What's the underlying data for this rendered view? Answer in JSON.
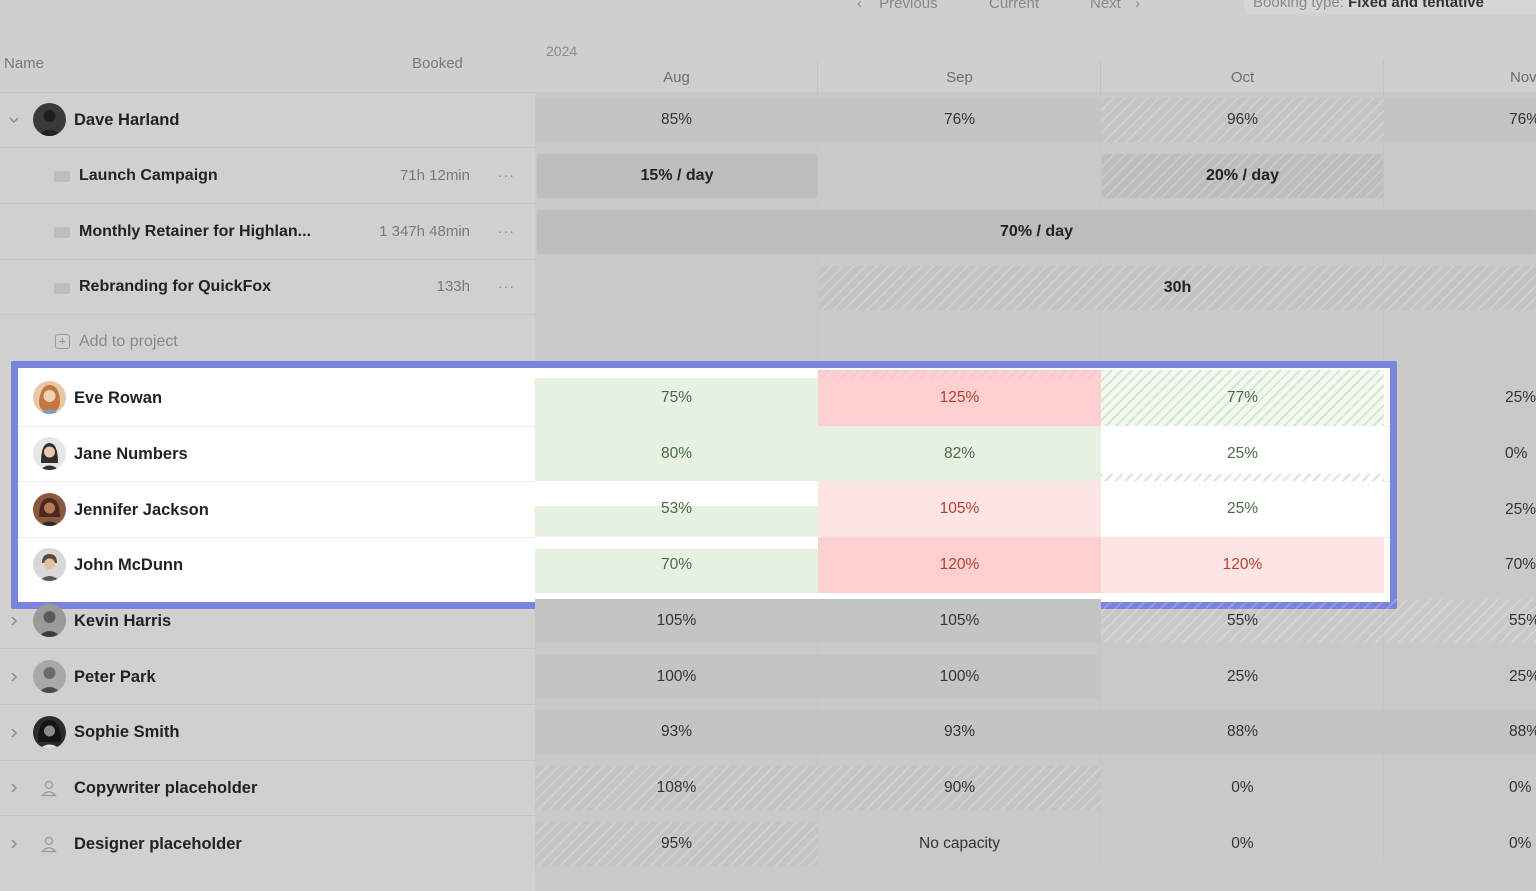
{
  "nav": {
    "previous": "Previous",
    "current": "Current",
    "next": "Next",
    "booking_label": "Booking type:",
    "booking_value": "Fixed and tentative"
  },
  "header": {
    "name_col": "Name",
    "booked_col": "Booked",
    "year": "2024",
    "months": [
      "Aug",
      "Sep",
      "Oct",
      "Nov"
    ]
  },
  "dave": {
    "name": "Dave Harland",
    "cells": [
      "85%",
      "76%",
      "96%",
      "76%"
    ],
    "projects": [
      {
        "name": "Launch Campaign",
        "hours": "71h 12min",
        "aug": "15% / day",
        "oct": "20% / day"
      },
      {
        "name": "Monthly Retainer for Highlan...",
        "hours": "1 347h 48min",
        "span": "70% / day"
      },
      {
        "name": "Rebranding for QuickFox",
        "hours": "133h",
        "span": "30h"
      }
    ],
    "add_to_project": "Add to project",
    "dots": "···"
  },
  "highlight_rows": [
    {
      "name": "Eve Rowan",
      "aug": "75%",
      "sep": "125%",
      "oct": "77%",
      "nov": "25%"
    },
    {
      "name": "Jane Numbers",
      "aug": "80%",
      "sep": "82%",
      "oct": "25%",
      "nov": "0%"
    },
    {
      "name": "Jennifer Jackson",
      "aug": "53%",
      "sep": "105%",
      "oct": "25%",
      "nov": "25%"
    },
    {
      "name": "John McDunn",
      "aug": "70%",
      "sep": "120%",
      "oct": "120%",
      "nov": "70%"
    }
  ],
  "lower_rows": [
    {
      "name": "Kevin Harris",
      "aug": "105%",
      "sep": "105%",
      "oct": "55%",
      "nov": "55%"
    },
    {
      "name": "Peter Park",
      "aug": "100%",
      "sep": "100%",
      "oct": "25%",
      "nov": "25%"
    },
    {
      "name": "Sophie Smith",
      "aug": "93%",
      "sep": "93%",
      "oct": "88%",
      "nov": "88%"
    },
    {
      "name": "Copywriter placeholder",
      "aug": "108%",
      "sep": "90%",
      "oct": "0%",
      "nov": "0%"
    },
    {
      "name": "Designer placeholder",
      "aug": "95%",
      "sep": "No capacity",
      "oct": "0%",
      "nov": "0%"
    }
  ],
  "colors": {
    "highlight_border": "#7b84dd",
    "ok_green": "#e6f1e2",
    "over_red": "#fbd0ce",
    "over_red_light": "#fde5e3"
  },
  "icons": [
    "chevron-left-icon",
    "chevron-right-icon",
    "chevron-down-icon",
    "folder-icon",
    "add-icon",
    "more-icon",
    "person-placeholder-icon"
  ]
}
